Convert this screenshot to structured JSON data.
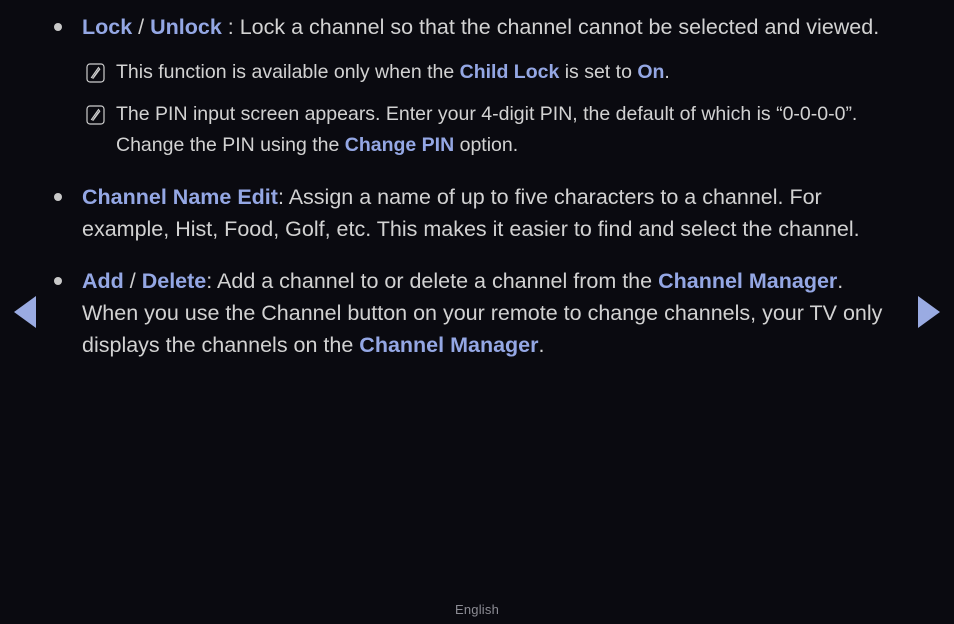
{
  "page": {
    "background_color": "#0a0a10",
    "body_text_color": "#d2d2d2",
    "keyword_color": "#94a7e4",
    "language_label": "English"
  },
  "nav": {
    "prev_icon": "triangle-left-icon",
    "next_icon": "triangle-right-icon",
    "prev_label": "Previous page",
    "next_label": "Next page"
  },
  "note_icon_name": "note-pencil-icon",
  "items": [
    {
      "type": "bullet",
      "kw1": "Lock",
      "sep": " / ",
      "kw2": "Unlock",
      "text": " : Lock a channel so that the channel cannot be selected and viewed."
    },
    {
      "type": "note",
      "pre": "This function is available only when the ",
      "kw1": "Child Lock",
      "mid": " is set to ",
      "kw2": "On",
      "post": "."
    },
    {
      "type": "note",
      "pre": "The PIN input screen appears. Enter your 4-digit PIN, the default of which is “0-0-0-0”. Change the PIN using the ",
      "kw1": "Change PIN",
      "post": " option."
    },
    {
      "type": "bullet",
      "kw1": "Channel Name Edit",
      "text": ": Assign a name of up to five characters to a channel. For example, Hist, Food, Golf, etc. This makes it easier to find and select the channel."
    },
    {
      "type": "bullet",
      "kw1": "Add",
      "sep": " / ",
      "kw2": "Delete",
      "text_a": ": Add a channel to or delete a channel from the ",
      "kw3": "Channel Manager",
      "text_b": ". When you use the Channel button on your remote to change channels, your TV only displays the channels on the ",
      "kw4": "Channel Manager",
      "text_c": "."
    }
  ]
}
